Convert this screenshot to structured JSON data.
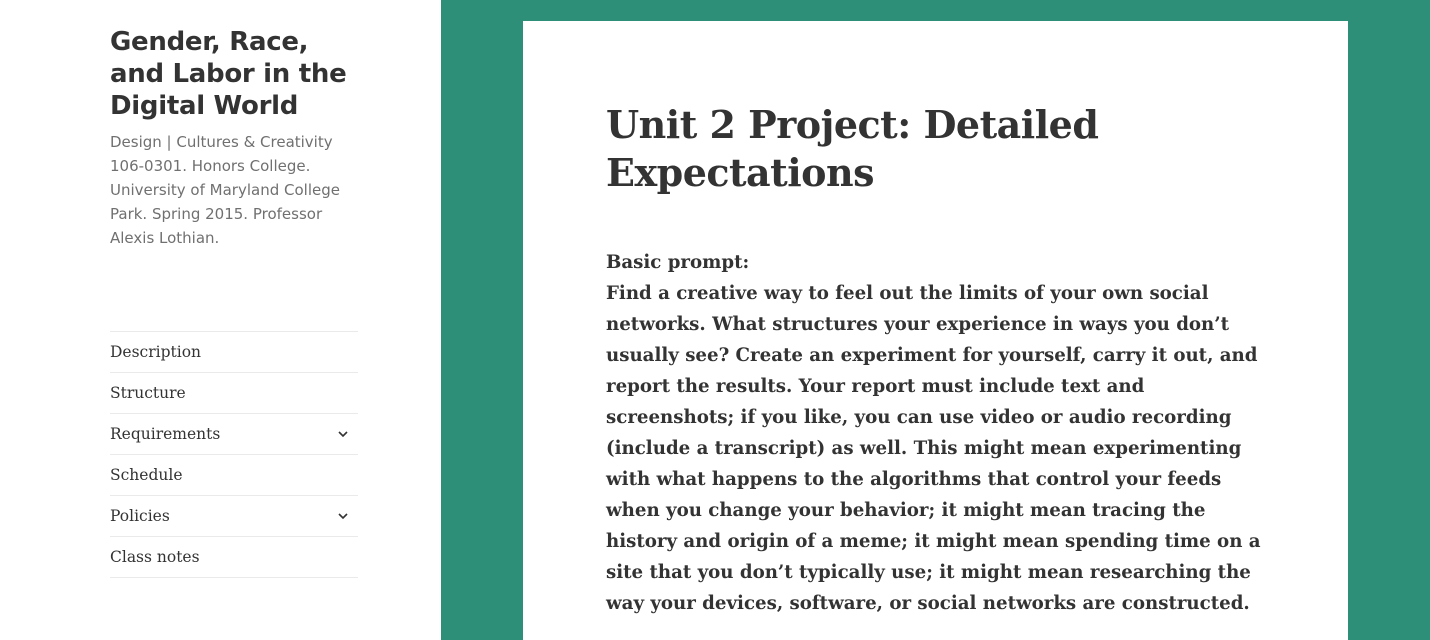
{
  "sidebar": {
    "site_title": "Gender, Race, and Labor in the Digital World",
    "site_description": "Design | Cultures & Creativity 106-0301. Honors College. University of Maryland College Park. Spring 2015. Professor Alexis Lothian.",
    "nav": [
      {
        "label": "Description",
        "has_submenu": false
      },
      {
        "label": "Structure",
        "has_submenu": false
      },
      {
        "label": "Requirements",
        "has_submenu": true
      },
      {
        "label": "Schedule",
        "has_submenu": false
      },
      {
        "label": "Policies",
        "has_submenu": true
      },
      {
        "label": "Class notes",
        "has_submenu": false
      }
    ],
    "submenu_icon": "chevron-down-icon"
  },
  "article": {
    "title": "Unit 2 Project: Detailed Expectations",
    "prompt_heading": "Basic prompt:",
    "prompt_text": "Find a creative way to feel out the limits of your own social networks. What structures your experience in ways you don’t usually see? Create an experiment for yourself, carry it out, and report the results. Your report must include text and screenshots; if you like, you can use video or audio recording (include a transcript) as well. This might mean experimenting with what happens to the algorithms that control your feeds when you change your behavior; it might mean tracing the history and origin of a meme; it might mean spending time on a site that you don’t typically use; it might mean researching the way your devices, software, or social networks are constructed."
  },
  "colors": {
    "accent": "#2e8f78",
    "text": "#333333",
    "muted": "#707070",
    "divider": "#eaeaea"
  }
}
